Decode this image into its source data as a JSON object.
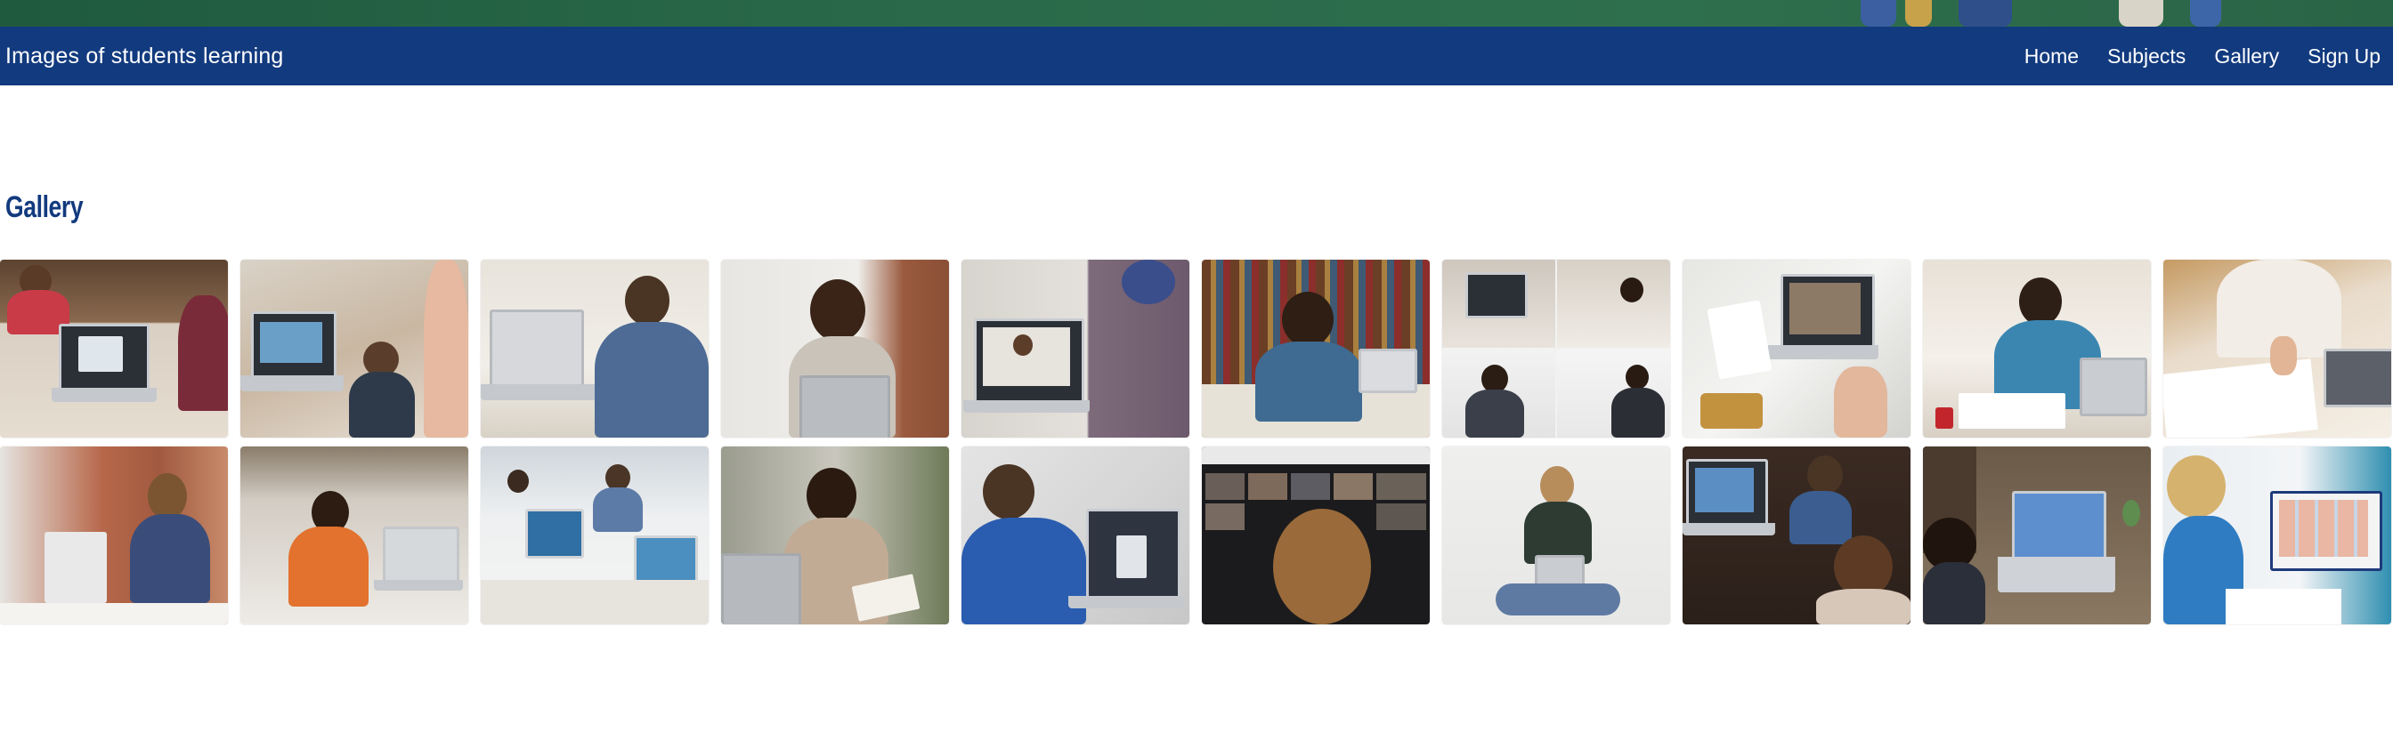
{
  "header": {
    "brand": "Images of students learning",
    "nav": [
      {
        "label": "Home"
      },
      {
        "label": "Subjects"
      },
      {
        "label": "Gallery"
      },
      {
        "label": "Sign Up"
      }
    ]
  },
  "main": {
    "section_title": "Gallery"
  },
  "colors": {
    "navbar": "#123a7e",
    "title": "#123a7e",
    "hero": "#2a6a4a"
  },
  "gallery": {
    "images": [
      {
        "name": "students-writing-laptop"
      },
      {
        "name": "boy-laptop-video-call"
      },
      {
        "name": "teen-laptop-desk"
      },
      {
        "name": "woman-headset-laptop"
      },
      {
        "name": "laptop-video-teacher"
      },
      {
        "name": "girl-headphones-bookshelf"
      },
      {
        "name": "video-call-collage"
      },
      {
        "name": "hand-waving-laptop-call"
      },
      {
        "name": "man-writing-notebook"
      },
      {
        "name": "hand-writing-notes"
      },
      {
        "name": "girl-studying-desk"
      },
      {
        "name": "girl-homework-desk"
      },
      {
        "name": "classroom-computers"
      },
      {
        "name": "woman-reading-book"
      },
      {
        "name": "boy-laptop-online-class"
      },
      {
        "name": "video-conference-grid"
      },
      {
        "name": "girl-sitting-laptop"
      },
      {
        "name": "kids-tablet-laptop"
      },
      {
        "name": "child-laptop-desk-overhead"
      },
      {
        "name": "boy-online-class-screen"
      }
    ]
  }
}
